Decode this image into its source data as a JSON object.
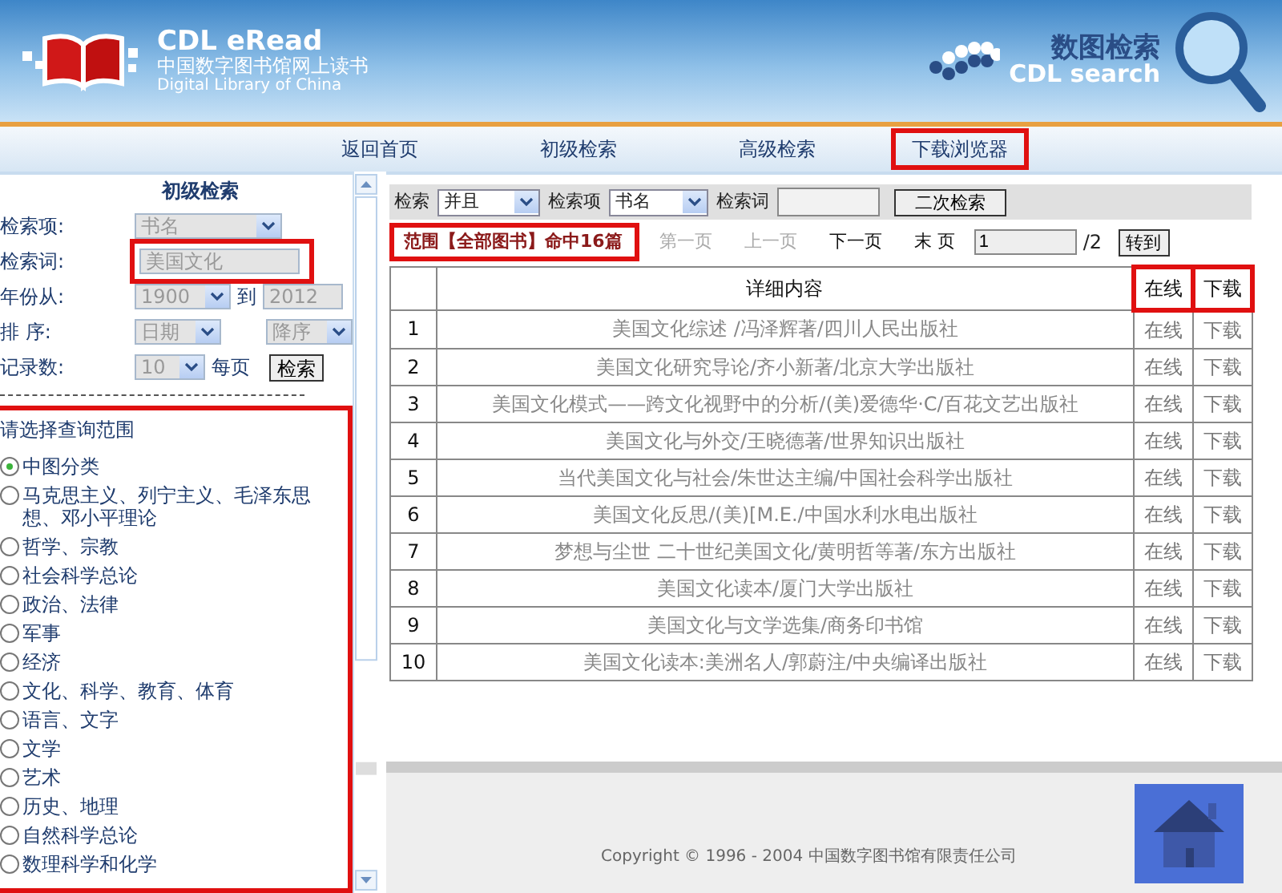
{
  "header": {
    "logo_title": "CDL eRead",
    "logo_subtitle": "中国数字图书馆网上读书",
    "logo_english": "Digital Library of China",
    "search_logo_cn": "数图检索",
    "search_logo_en": "CDL search"
  },
  "nav": [
    {
      "label": "返回首页",
      "highlighted": false
    },
    {
      "label": "初级检索",
      "highlighted": false
    },
    {
      "label": "高级检索",
      "highlighted": false
    },
    {
      "label": "下载浏览器",
      "highlighted": true
    }
  ],
  "sidebar": {
    "title": "初级检索",
    "search_item": {
      "label": "检索项:",
      "value": "书名"
    },
    "search_term": {
      "label": "检索词:",
      "value": "美国文化",
      "highlighted": true
    },
    "year": {
      "label": "年份从:",
      "from": "1900",
      "to_label": "到",
      "to": "2012"
    },
    "sort": {
      "label": "排 序:",
      "field": "日期",
      "order": "降序"
    },
    "records": {
      "label": "记录数:",
      "value": "10",
      "unit": "每页",
      "button": "检索"
    },
    "scope": {
      "title": "请选择查询范围",
      "highlighted": true,
      "categories": [
        {
          "label": "中图分类",
          "selected": true
        },
        {
          "label": "马克思主义、列宁主义、毛泽东思想、邓小平理论",
          "selected": false
        },
        {
          "label": "哲学、宗教",
          "selected": false
        },
        {
          "label": "社会科学总论",
          "selected": false
        },
        {
          "label": "政治、法律",
          "selected": false
        },
        {
          "label": "军事",
          "selected": false
        },
        {
          "label": "经济",
          "selected": false
        },
        {
          "label": "文化、科学、教育、体育",
          "selected": false
        },
        {
          "label": "语言、文字",
          "selected": false
        },
        {
          "label": "文学",
          "selected": false
        },
        {
          "label": "艺术",
          "selected": false
        },
        {
          "label": "历史、地理",
          "selected": false
        },
        {
          "label": "自然科学总论",
          "selected": false
        },
        {
          "label": "数理科学和化学",
          "selected": false
        }
      ]
    }
  },
  "refine": {
    "search_label": "检索",
    "logic": "并且",
    "item_label": "检索项",
    "item": "书名",
    "term_label": "检索词",
    "button": "二次检索"
  },
  "pager": {
    "summary": "范围【全部图书】命中16篇",
    "summary_highlighted": true,
    "links": [
      {
        "label": "第一页",
        "disabled": true
      },
      {
        "label": "上一页",
        "disabled": true
      },
      {
        "label": "下一页",
        "disabled": false
      },
      {
        "label": "末 页",
        "disabled": false
      }
    ],
    "page": "1",
    "total": "/2",
    "go": "转到"
  },
  "table": {
    "columns": [
      {
        "highlighted": false
      },
      {
        "label": "详细内容",
        "highlighted": false
      },
      {
        "label": "在线",
        "highlighted": true
      },
      {
        "label": "下载",
        "highlighted": true
      }
    ],
    "rows": [
      {
        "no": "1",
        "detail": "美国文化综述 /冯泽辉著/四川人民出版社",
        "online": "在线",
        "download": "下载"
      },
      {
        "no": "2",
        "detail": "美国文化研究导论/齐小新著/北京大学出版社",
        "online": "在线",
        "download": "下载"
      },
      {
        "no": "3",
        "detail": "美国文化模式——跨文化视野中的分析/(美)爱德华·C/百花文艺出版社",
        "online": "在线",
        "download": "下载"
      },
      {
        "no": "4",
        "detail": "美国文化与外交/王晓德著/世界知识出版社",
        "online": "在线",
        "download": "下载"
      },
      {
        "no": "5",
        "detail": "当代美国文化与社会/朱世达主编/中国社会科学出版社",
        "online": "在线",
        "download": "下载"
      },
      {
        "no": "6",
        "detail": "美国文化反思/(美)[M.E./中国水利水电出版社",
        "online": "在线",
        "download": "下载"
      },
      {
        "no": "7",
        "detail": "梦想与尘世 二十世纪美国文化/黄明哲等著/东方出版社",
        "online": "在线",
        "download": "下载"
      },
      {
        "no": "8",
        "detail": "美国文化读本/厦门大学出版社",
        "online": "在线",
        "download": "下载"
      },
      {
        "no": "9",
        "detail": "美国文化与文学选集/商务印书馆",
        "online": "在线",
        "download": "下载"
      },
      {
        "no": "10",
        "detail": "美国文化读本:美洲名人/郭蔚注/中央编译出版社",
        "online": "在线",
        "download": "下载"
      }
    ]
  },
  "footer": {
    "copyright": "Copyright © 1996 - 2004  中国数字图书馆有限责任公司"
  }
}
